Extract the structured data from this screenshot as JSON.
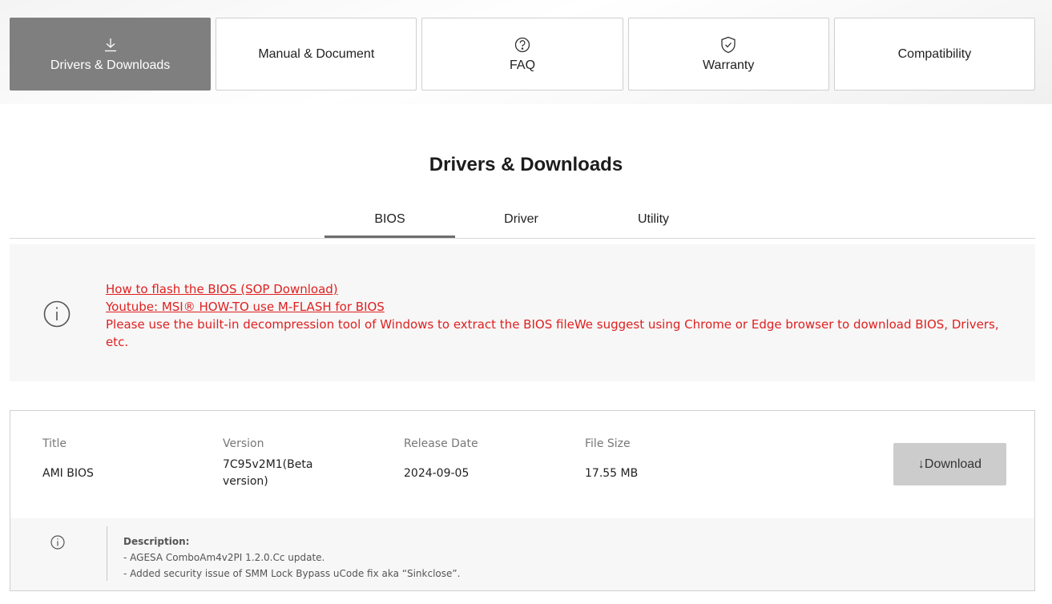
{
  "top_tabs": [
    {
      "label": "Drivers & Downloads",
      "icon": "download-icon",
      "active": true
    },
    {
      "label": "Manual & Document",
      "icon": "",
      "active": false
    },
    {
      "label": "FAQ",
      "icon": "question-circle-icon",
      "active": false
    },
    {
      "label": "Warranty",
      "icon": "shield-check-icon",
      "active": false
    },
    {
      "label": "Compatibility",
      "icon": "",
      "active": false
    }
  ],
  "section_title": "Drivers & Downloads",
  "sub_tabs": [
    {
      "label": "BIOS",
      "active": true
    },
    {
      "label": "Driver",
      "active": false
    },
    {
      "label": "Utility",
      "active": false
    }
  ],
  "notice": {
    "link1": "How to flash the BIOS (SOP Download)",
    "link2": "Youtube: MSI® HOW-TO use M-FLASH for BIOS",
    "text": "Please use the built-in decompression tool of Windows to extract the BIOS fileWe suggest using Chrome or Edge browser to download BIOS, Drivers, etc."
  },
  "bios": {
    "headers": {
      "title": "Title",
      "version": "Version",
      "date": "Release Date",
      "size": "File Size"
    },
    "title": "AMI BIOS",
    "version": "7C95v2M1(Beta version)",
    "date": "2024-09-05",
    "size": "17.55 MB",
    "download_label": "Download",
    "description_head": "Description:",
    "description_lines": [
      "- AGESA ComboAm4v2PI 1.2.0.Cc update.",
      "- Added security issue of SMM Lock Bypass uCode fix aka “Sinkclose”."
    ]
  },
  "colors": {
    "accent_red": "#e02020",
    "active_tab": "#7f7f7f",
    "download_button": "#cccccc"
  }
}
